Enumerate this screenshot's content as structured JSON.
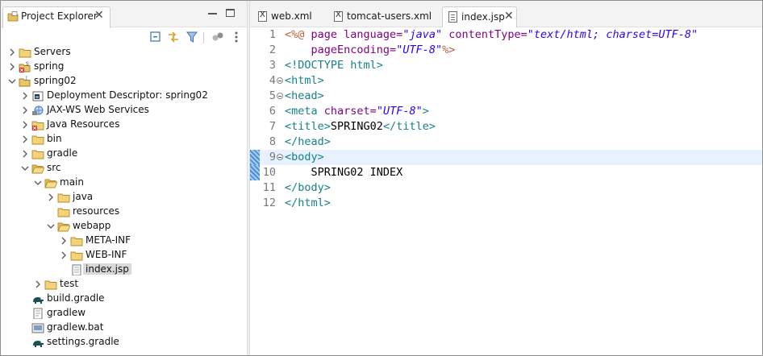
{
  "explorer": {
    "title": "Project Explorer",
    "close_glyph": "✕",
    "tree": [
      {
        "label": "Servers",
        "icon": "folder-icon",
        "arrow": "collapsed"
      },
      {
        "label": "spring",
        "icon": "project-error-icon",
        "arrow": "collapsed"
      },
      {
        "label": "spring02",
        "icon": "project-icon",
        "arrow": "expanded"
      },
      {
        "label": "Deployment Descriptor: spring02",
        "icon": "deployment-descriptor-icon",
        "arrow": "collapsed"
      },
      {
        "label": "JAX-WS Web Services",
        "icon": "web-services-icon",
        "arrow": "collapsed"
      },
      {
        "label": "Java Resources",
        "icon": "java-resources-icon",
        "arrow": "collapsed"
      },
      {
        "label": "bin",
        "icon": "folder-icon",
        "arrow": "collapsed"
      },
      {
        "label": "gradle",
        "icon": "folder-icon",
        "arrow": "collapsed"
      },
      {
        "label": "src",
        "icon": "folder-open-icon",
        "arrow": "expanded"
      },
      {
        "label": "main",
        "icon": "folder-open-icon",
        "arrow": "expanded"
      },
      {
        "label": "java",
        "icon": "folder-icon",
        "arrow": "collapsed"
      },
      {
        "label": "resources",
        "icon": "folder-icon",
        "arrow": "none"
      },
      {
        "label": "webapp",
        "icon": "folder-open-icon",
        "arrow": "expanded"
      },
      {
        "label": "META-INF",
        "icon": "folder-icon",
        "arrow": "collapsed"
      },
      {
        "label": "WEB-INF",
        "icon": "folder-icon",
        "arrow": "collapsed"
      },
      {
        "label": "index.jsp",
        "icon": "jsp-file-icon",
        "arrow": "none",
        "selected": true
      },
      {
        "label": "test",
        "icon": "folder-icon",
        "arrow": "collapsed"
      },
      {
        "label": "build.gradle",
        "icon": "gradle-elephant-icon",
        "arrow": "none"
      },
      {
        "label": "gradlew",
        "icon": "text-file-icon",
        "arrow": "none"
      },
      {
        "label": "gradlew.bat",
        "icon": "batch-file-icon",
        "arrow": "none"
      },
      {
        "label": "settings.gradle",
        "icon": "gradle-elephant-icon",
        "arrow": "none"
      }
    ]
  },
  "editor": {
    "tabs": [
      {
        "label": "web.xml",
        "icon": "xml-file-icon",
        "active": false
      },
      {
        "label": "tomcat-users.xml",
        "icon": "xml-file-icon",
        "active": false
      },
      {
        "label": "index.jsp",
        "icon": "jsp-file-icon",
        "active": true
      }
    ],
    "close_glyph": "✕",
    "current_line": 9,
    "lines": [
      {
        "n": "1",
        "fold": false,
        "tokens": [
          [
            "jsp",
            "<%@ "
          ],
          [
            "kw",
            "page "
          ],
          [
            "attr",
            "language="
          ],
          [
            "str",
            "\"java\""
          ],
          [
            "txt",
            " "
          ],
          [
            "attr",
            "contentType="
          ],
          [
            "str",
            "\"text/html; charset=UTF-8\""
          ]
        ]
      },
      {
        "n": "2",
        "fold": false,
        "tokens": [
          [
            "txt",
            "    "
          ],
          [
            "attr",
            "pageEncoding="
          ],
          [
            "str",
            "\"UTF-8\""
          ],
          [
            "jsp",
            "%>"
          ]
        ]
      },
      {
        "n": "3",
        "fold": false,
        "tokens": [
          [
            "tag",
            "<!DOCTYPE "
          ],
          [
            "tag",
            "html"
          ],
          [
            "tag",
            ">"
          ]
        ]
      },
      {
        "n": "4",
        "fold": true,
        "tokens": [
          [
            "tag",
            "<html>"
          ]
        ]
      },
      {
        "n": "5",
        "fold": true,
        "tokens": [
          [
            "tag",
            "<head>"
          ]
        ]
      },
      {
        "n": "6",
        "fold": false,
        "tokens": [
          [
            "tag",
            "<meta "
          ],
          [
            "attr",
            "charset="
          ],
          [
            "str",
            "\"UTF-8\""
          ],
          [
            "tag",
            ">"
          ]
        ]
      },
      {
        "n": "7",
        "fold": false,
        "tokens": [
          [
            "tag",
            "<title>"
          ],
          [
            "txt",
            "SPRING02"
          ],
          [
            "tag",
            "</title>"
          ]
        ]
      },
      {
        "n": "8",
        "fold": false,
        "tokens": [
          [
            "tag",
            "</head>"
          ]
        ]
      },
      {
        "n": "9",
        "fold": true,
        "tokens": [
          [
            "tag",
            "<body>"
          ]
        ]
      },
      {
        "n": "10",
        "fold": false,
        "tokens": [
          [
            "txt",
            "    SPRING02 INDEX"
          ]
        ]
      },
      {
        "n": "11",
        "fold": false,
        "tokens": [
          [
            "tag",
            "</body>"
          ]
        ]
      },
      {
        "n": "12",
        "fold": false,
        "tokens": [
          [
            "tag",
            "</html>"
          ]
        ]
      }
    ]
  },
  "colors": {
    "selection": "#d9d9d9",
    "current_line_bg": "#e8f2fe",
    "tag": "#17808a",
    "attr": "#7f007f",
    "string": "#2a00ff",
    "jsp": "#bf5f3f"
  }
}
